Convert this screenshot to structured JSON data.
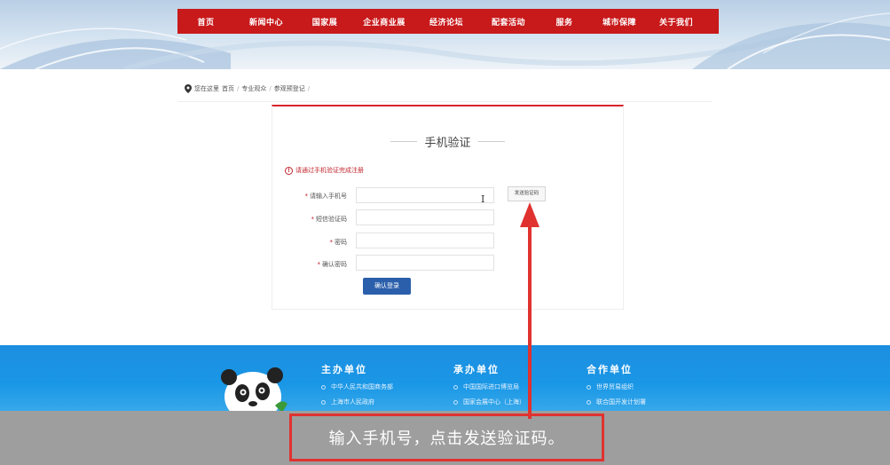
{
  "nav": {
    "items": [
      "首页",
      "新闻中心",
      "国家展",
      "企业商业展",
      "经济论坛",
      "配套活动",
      "服务",
      "城市保障",
      "关于我们"
    ]
  },
  "breadcrumb": {
    "prefix": "您在这里",
    "items": [
      "首页",
      "专业观众",
      "参观预登记"
    ]
  },
  "form": {
    "title": "手机验证",
    "notice": "请通过手机验证完成注册",
    "fields": [
      {
        "label": "请输入手机号",
        "value": ""
      },
      {
        "label": "短信验证码",
        "value": ""
      },
      {
        "label": "密码",
        "value": ""
      },
      {
        "label": "确认密码",
        "value": ""
      }
    ],
    "send_code_label": "发送验证码",
    "submit_label": "确认登录"
  },
  "footer": {
    "columns": [
      {
        "title": "主办单位",
        "items": [
          "中华人民共和国商务部",
          "上海市人民政府"
        ]
      },
      {
        "title": "承办单位",
        "items": [
          "中国国际进口博览局",
          "国家会展中心（上海）"
        ]
      },
      {
        "title": "合作单位",
        "items": [
          "世界贸易组织",
          "联合国开发计划署"
        ]
      }
    ]
  },
  "caption": {
    "text": "输入手机号，点击发送验证码。"
  },
  "colors": {
    "nav_bg": "#c8191b",
    "accent_red": "#d9232a",
    "submit_blue": "#2b5fab",
    "footer_blue": "#1a97e6",
    "arrow_red": "#e0322f"
  },
  "icons": {
    "breadcrumb": "location-pin-icon",
    "notice": "warning-circle-icon",
    "cursor": "text-cursor-icon",
    "mascot": "panda-mascot"
  }
}
